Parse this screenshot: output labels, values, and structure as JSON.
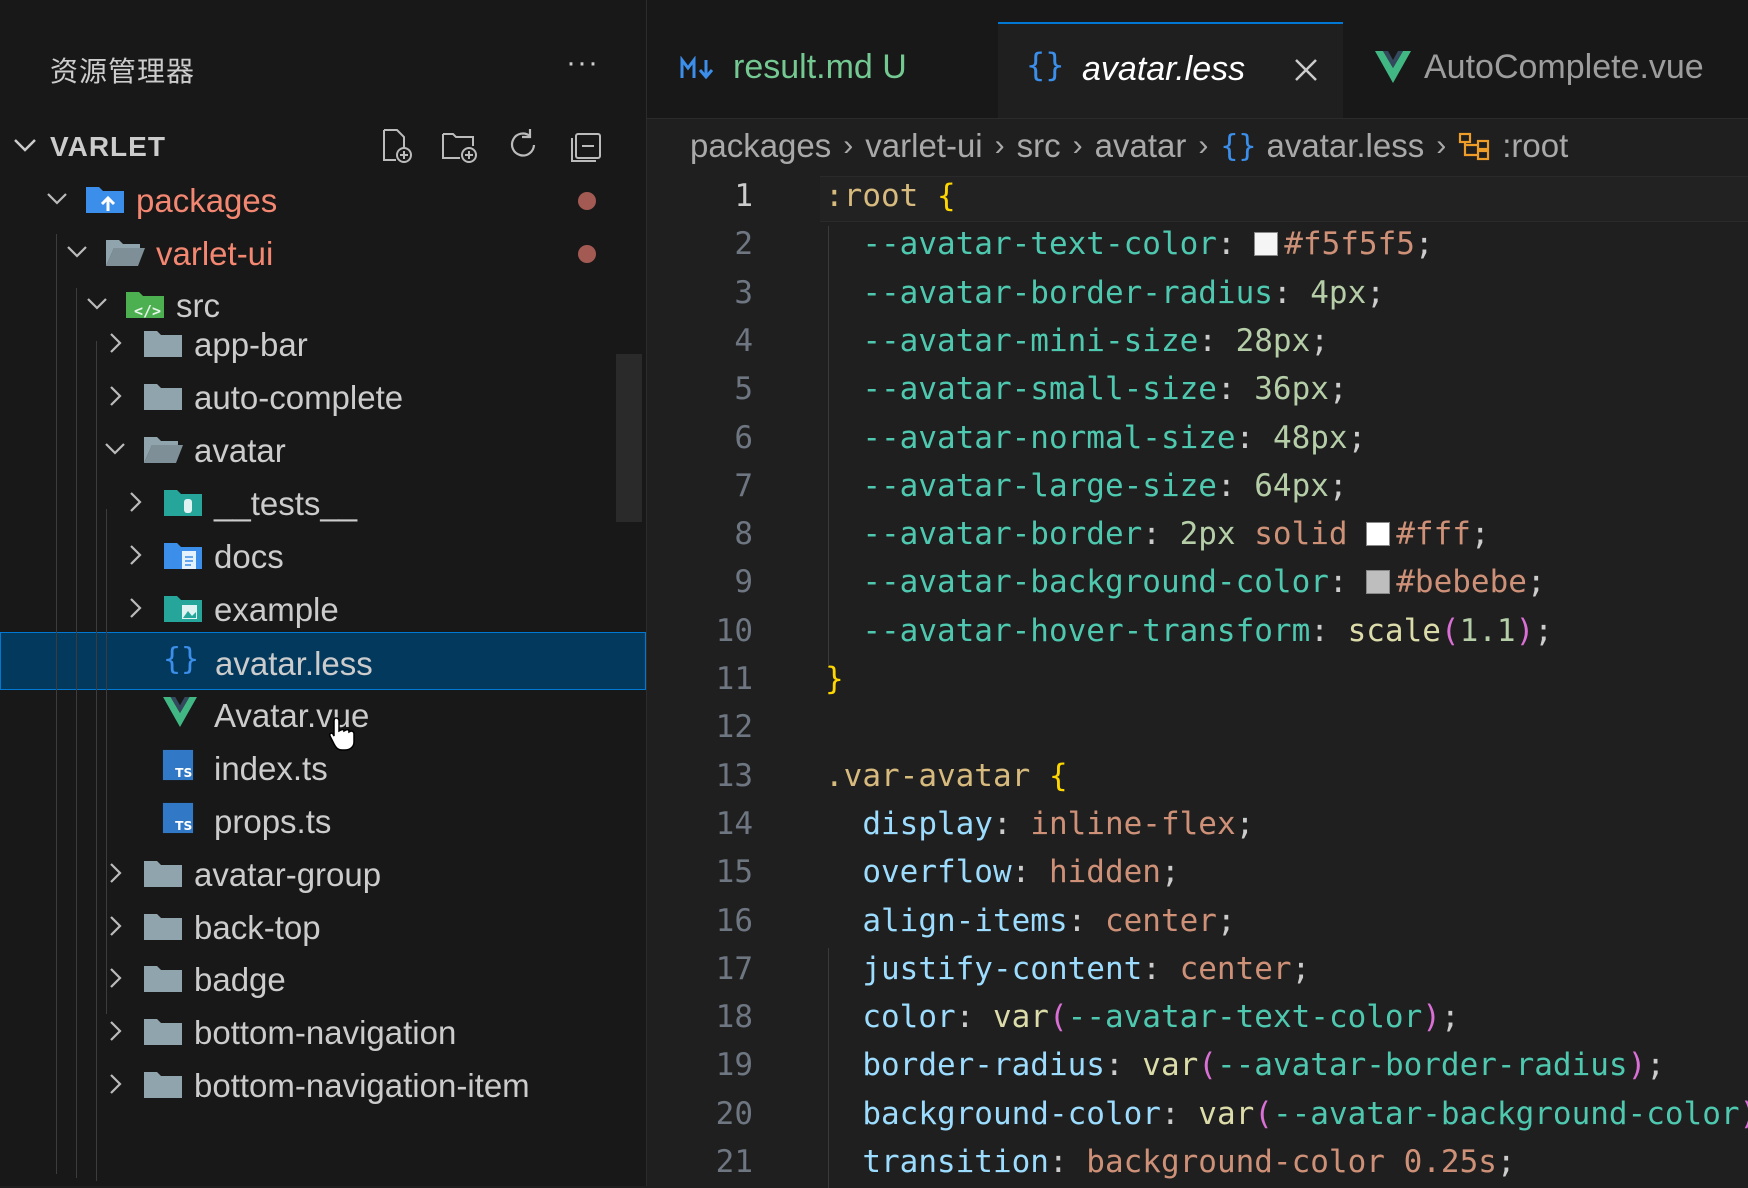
{
  "explorer": {
    "title": "资源管理器",
    "more": "···",
    "project": "VARLET",
    "actions": [
      "new-file-icon",
      "new-folder-icon",
      "refresh-icon",
      "collapse-all-icon"
    ]
  },
  "tree": [
    {
      "label": "packages",
      "type": "folder-special",
      "expanded": true,
      "modified": true,
      "depth": 0
    },
    {
      "label": "varlet-ui",
      "type": "folder",
      "expanded": true,
      "modified": true,
      "depth": 1
    },
    {
      "label": "src",
      "type": "folder-src",
      "expanded": true,
      "depth": 2
    },
    {
      "label": "app-bar",
      "type": "folder",
      "expanded": false,
      "depth": 3
    },
    {
      "label": "auto-complete",
      "type": "folder",
      "expanded": false,
      "depth": 3
    },
    {
      "label": "avatar",
      "type": "folder",
      "expanded": true,
      "depth": 3
    },
    {
      "label": "__tests__",
      "type": "folder-test",
      "expanded": false,
      "depth": 4
    },
    {
      "label": "docs",
      "type": "folder-docs",
      "expanded": false,
      "depth": 4
    },
    {
      "label": "example",
      "type": "folder-example",
      "expanded": false,
      "depth": 4
    },
    {
      "label": "avatar.less",
      "type": "less",
      "depth": 4,
      "selected": true
    },
    {
      "label": "Avatar.vue",
      "type": "vue",
      "depth": 4
    },
    {
      "label": "index.ts",
      "type": "ts",
      "depth": 4
    },
    {
      "label": "props.ts",
      "type": "ts",
      "depth": 4
    },
    {
      "label": "avatar-group",
      "type": "folder",
      "expanded": false,
      "depth": 3
    },
    {
      "label": "back-top",
      "type": "folder",
      "expanded": false,
      "depth": 3
    },
    {
      "label": "badge",
      "type": "folder",
      "expanded": false,
      "depth": 3
    },
    {
      "label": "bottom-navigation",
      "type": "folder",
      "expanded": false,
      "depth": 3
    },
    {
      "label": "bottom-navigation-item",
      "type": "folder",
      "expanded": false,
      "depth": 3
    }
  ],
  "tabs": [
    {
      "label": "result.md",
      "status": "U",
      "icon": "markdown-icon",
      "active": false
    },
    {
      "label": "avatar.less",
      "icon": "less-braces-icon",
      "active": true
    },
    {
      "label": "AutoComplete.vue",
      "icon": "vue-icon",
      "active": false
    }
  ],
  "breadcrumb": {
    "items": [
      "packages",
      "varlet-ui",
      "src",
      "avatar",
      "avatar.less",
      ":root"
    ]
  },
  "editor": {
    "active_line": 1,
    "lines": [
      [
        {
          "t": ":root ",
          "c": "t-sel"
        },
        {
          "t": "{",
          "c": "t-brace"
        }
      ],
      [
        {
          "t": "  --avatar-text-color",
          "c": "t-var"
        },
        {
          "t": ": ",
          "c": "t-punc"
        },
        {
          "sw": "#f5f5f5"
        },
        {
          "t": "#f5f5f5",
          "c": "t-str"
        },
        {
          "t": ";",
          "c": "t-punc"
        }
      ],
      [
        {
          "t": "  --avatar-border-radius",
          "c": "t-var"
        },
        {
          "t": ": ",
          "c": "t-punc"
        },
        {
          "t": "4px",
          "c": "t-num"
        },
        {
          "t": ";",
          "c": "t-punc"
        }
      ],
      [
        {
          "t": "  --avatar-mini-size",
          "c": "t-var"
        },
        {
          "t": ": ",
          "c": "t-punc"
        },
        {
          "t": "28px",
          "c": "t-num"
        },
        {
          "t": ";",
          "c": "t-punc"
        }
      ],
      [
        {
          "t": "  --avatar-small-size",
          "c": "t-var"
        },
        {
          "t": ": ",
          "c": "t-punc"
        },
        {
          "t": "36px",
          "c": "t-num"
        },
        {
          "t": ";",
          "c": "t-punc"
        }
      ],
      [
        {
          "t": "  --avatar-normal-size",
          "c": "t-var"
        },
        {
          "t": ": ",
          "c": "t-punc"
        },
        {
          "t": "48px",
          "c": "t-num"
        },
        {
          "t": ";",
          "c": "t-punc"
        }
      ],
      [
        {
          "t": "  --avatar-large-size",
          "c": "t-var"
        },
        {
          "t": ": ",
          "c": "t-punc"
        },
        {
          "t": "64px",
          "c": "t-num"
        },
        {
          "t": ";",
          "c": "t-punc"
        }
      ],
      [
        {
          "t": "  --avatar-border",
          "c": "t-var"
        },
        {
          "t": ": ",
          "c": "t-punc"
        },
        {
          "t": "2px",
          "c": "t-num"
        },
        {
          "t": " solid ",
          "c": "t-str"
        },
        {
          "sw": "#ffffff"
        },
        {
          "t": "#fff",
          "c": "t-str"
        },
        {
          "t": ";",
          "c": "t-punc"
        }
      ],
      [
        {
          "t": "  --avatar-background-color",
          "c": "t-var"
        },
        {
          "t": ": ",
          "c": "t-punc"
        },
        {
          "sw": "#bebebe"
        },
        {
          "t": "#bebebe",
          "c": "t-str"
        },
        {
          "t": ";",
          "c": "t-punc"
        }
      ],
      [
        {
          "t": "  --avatar-hover-transform",
          "c": "t-var"
        },
        {
          "t": ": ",
          "c": "t-punc"
        },
        {
          "t": "scale",
          "c": "t-fn"
        },
        {
          "t": "(",
          "c": "t-paren"
        },
        {
          "t": "1.1",
          "c": "t-num"
        },
        {
          "t": ")",
          "c": "t-paren"
        },
        {
          "t": ";",
          "c": "t-punc"
        }
      ],
      [
        {
          "t": "}",
          "c": "t-brace"
        }
      ],
      [],
      [
        {
          "t": ".var-avatar ",
          "c": "t-sel"
        },
        {
          "t": "{",
          "c": "t-brace"
        }
      ],
      [
        {
          "t": "  display",
          "c": "t-prop"
        },
        {
          "t": ": ",
          "c": "t-punc"
        },
        {
          "t": "inline-flex",
          "c": "t-str"
        },
        {
          "t": ";",
          "c": "t-punc"
        }
      ],
      [
        {
          "t": "  overflow",
          "c": "t-prop"
        },
        {
          "t": ": ",
          "c": "t-punc"
        },
        {
          "t": "hidden",
          "c": "t-str"
        },
        {
          "t": ";",
          "c": "t-punc"
        }
      ],
      [
        {
          "t": "  align-items",
          "c": "t-prop"
        },
        {
          "t": ": ",
          "c": "t-punc"
        },
        {
          "t": "center",
          "c": "t-str"
        },
        {
          "t": ";",
          "c": "t-punc"
        }
      ],
      [
        {
          "t": "  justify-content",
          "c": "t-prop"
        },
        {
          "t": ": ",
          "c": "t-punc"
        },
        {
          "t": "center",
          "c": "t-str"
        },
        {
          "t": ";",
          "c": "t-punc"
        }
      ],
      [
        {
          "t": "  color",
          "c": "t-prop"
        },
        {
          "t": ": ",
          "c": "t-punc"
        },
        {
          "t": "var",
          "c": "t-fn"
        },
        {
          "t": "(",
          "c": "t-paren"
        },
        {
          "t": "--avatar-text-color",
          "c": "t-var"
        },
        {
          "t": ")",
          "c": "t-paren"
        },
        {
          "t": ";",
          "c": "t-punc"
        }
      ],
      [
        {
          "t": "  border-radius",
          "c": "t-prop"
        },
        {
          "t": ": ",
          "c": "t-punc"
        },
        {
          "t": "var",
          "c": "t-fn"
        },
        {
          "t": "(",
          "c": "t-paren"
        },
        {
          "t": "--avatar-border-radius",
          "c": "t-var"
        },
        {
          "t": ")",
          "c": "t-paren"
        },
        {
          "t": ";",
          "c": "t-punc"
        }
      ],
      [
        {
          "t": "  background-color",
          "c": "t-prop"
        },
        {
          "t": ": ",
          "c": "t-punc"
        },
        {
          "t": "var",
          "c": "t-fn"
        },
        {
          "t": "(",
          "c": "t-paren"
        },
        {
          "t": "--avatar-background-color",
          "c": "t-var"
        },
        {
          "t": ")",
          "c": "t-paren"
        },
        {
          "t": ";",
          "c": "t-punc"
        }
      ],
      [
        {
          "t": "  transition",
          "c": "t-prop"
        },
        {
          "t": ": ",
          "c": "t-punc"
        },
        {
          "t": "background-color 0.25s",
          "c": "t-str"
        },
        {
          "t": ";",
          "c": "t-punc"
        }
      ]
    ]
  },
  "colors": {
    "accent": "#0078d4",
    "modified": "#f48771",
    "sidebar_bg": "#181818",
    "editor_bg": "#1f1f1f"
  }
}
